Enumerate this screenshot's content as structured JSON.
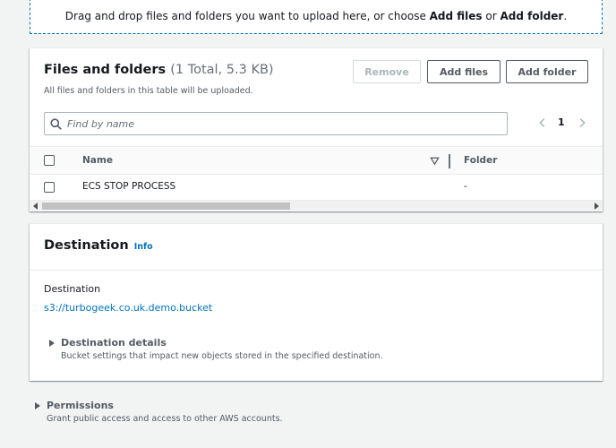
{
  "dropzone": {
    "prefix": "Drag and drop files and folders you want to upload here, or choose ",
    "add_files": "Add files",
    "or": " or ",
    "add_folder": "Add folder",
    "suffix": "."
  },
  "files": {
    "title": "Files and folders",
    "count": "(1 Total, 5.3 KB)",
    "description": "All files and folders in this table will be uploaded.",
    "buttons": {
      "remove": "Remove",
      "add_files": "Add files",
      "add_folder": "Add folder"
    },
    "search": {
      "placeholder": "Find by name",
      "value": "",
      "icon": "search-icon"
    },
    "pagination": {
      "current_page": "1"
    },
    "columns": {
      "name": "Name",
      "folder": "Folder"
    },
    "rows": [
      {
        "name": "ECS STOP PROCESS",
        "folder": "-"
      }
    ]
  },
  "destination": {
    "title": "Destination",
    "info": "Info",
    "field_label": "Destination",
    "field_value": "s3://turbogeek.co.uk.demo.bucket",
    "details": {
      "title": "Destination details",
      "description": "Bucket settings that impact new objects stored in the specified destination."
    }
  },
  "permissions": {
    "title": "Permissions",
    "description": "Grant public access and access to other AWS accounts."
  },
  "colors": {
    "link": "#0073bb",
    "text": "#16191f",
    "muted": "#545b64",
    "background": "#f2f3f3"
  }
}
